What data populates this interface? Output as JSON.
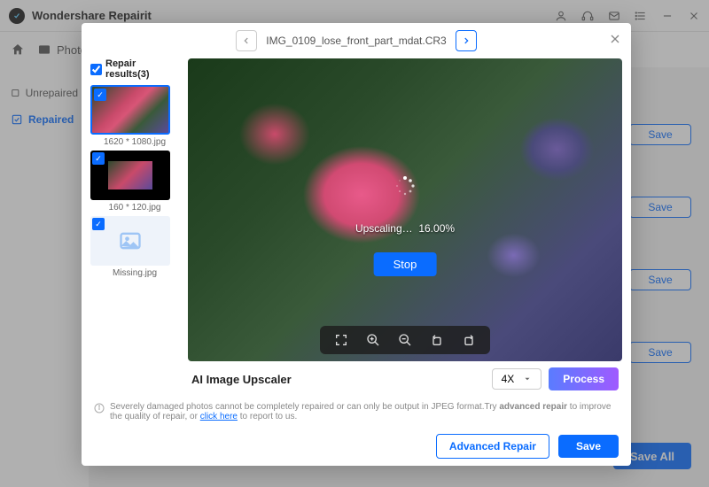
{
  "app": {
    "title": "Wondershare Repairit"
  },
  "toolbar": {
    "photos": "Photos"
  },
  "sidebar": {
    "unrepaired": "Unrepaired",
    "repaired": "Repaired"
  },
  "right": {
    "save": "Save",
    "save_all": "Save All"
  },
  "modal": {
    "filename": "IMG_0109_lose_front_part_mdat.CR3",
    "results_label": "Repair results(3)",
    "thumbs": [
      {
        "label": "1620 * 1080.jpg"
      },
      {
        "label": "160 * 120.jpg"
      },
      {
        "label": "Missing.jpg"
      }
    ],
    "progress": {
      "label": "Upscaling…",
      "percent": "16.00%"
    },
    "stop": "Stop",
    "upscaler": {
      "label": "AI Image Upscaler",
      "multiplier": "4X",
      "process": "Process"
    },
    "info": {
      "text1": "Severely damaged photos cannot be completely repaired or can only be output in JPEG format.Try ",
      "bold": "advanced repair",
      "text2": " to improve the quality of repair, or ",
      "link": "click here",
      "text3": " to report to us."
    },
    "footer": {
      "advanced": "Advanced Repair",
      "save": "Save"
    }
  }
}
